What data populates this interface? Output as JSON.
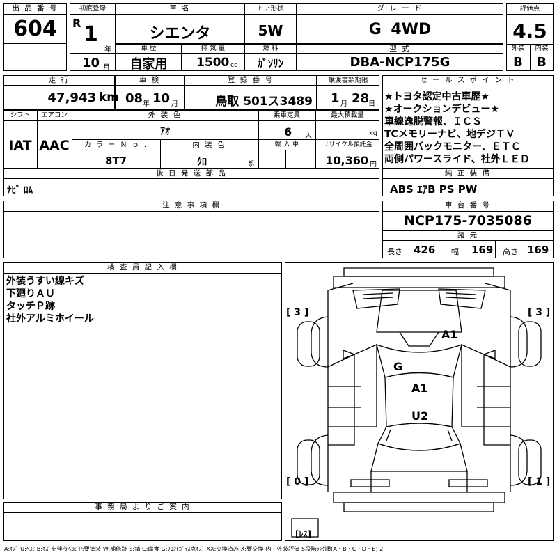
{
  "header": {
    "lot_no_label": "出 品 番 号",
    "lot_no": "604",
    "first_reg_label": "初度登録",
    "first_reg_era": "R",
    "first_reg_year": "1",
    "year_unit": "年",
    "first_reg_month": "10",
    "month_unit": "月",
    "car_name_label": "車 名",
    "car_name": "シエンタ",
    "door_label": "ドア形状",
    "door": "5W",
    "grade_label": "グ レ ー ド",
    "grade": "G 4WD",
    "score_label": "評価点",
    "score": "4.5",
    "history_label": "車 歴",
    "history": "自家用",
    "displacement_label": "排 気 量",
    "displacement": "1500",
    "displacement_unit": "cc",
    "fuel_label": "燃 料",
    "fuel": "ｶﾞｿﾘﾝ",
    "model_label": "型 式",
    "model": "DBA-NCP175G",
    "exterior_label": "外装",
    "exterior_grade": "B",
    "interior_label": "内装",
    "interior_grade": "B"
  },
  "row2": {
    "mileage_label": "走 行",
    "mileage": "47,943",
    "mileage_unit": "km",
    "inspection_label": "車 検",
    "inspection_year": "08",
    "inspection_year_unit": "年",
    "inspection_month": "10",
    "inspection_month_unit": "月",
    "plate_label": "登 録 番 号",
    "plate": "鳥取 501ス3489",
    "transfer_label": "譲渡書類期限",
    "transfer_month": "1",
    "transfer_month_unit": "月",
    "transfer_day": "28",
    "transfer_day_unit": "日"
  },
  "row3": {
    "shift_label": "シフト",
    "shift": "IAT",
    "ac_label": "エアコン",
    "ac": "AAC",
    "ext_color_label": "外 装 色",
    "ext_color": "ｱｵ",
    "capacity_label": "乗車定員",
    "capacity": "6",
    "capacity_unit": "人",
    "max_load_label": "最大積載量",
    "max_load_unit": "kg",
    "color_no_label": "カ ラ ー Ｎ ｏ .",
    "color_no": "8T7",
    "int_color_label": "内 装 色",
    "int_color": "ｸﾛ",
    "int_color_unit": "系",
    "import_label": "輸 入 車",
    "recycle_label": "リサイクル預託金",
    "recycle": "10,360",
    "recycle_unit": "円"
  },
  "later_parts": {
    "label": "後 日 発 送 部 品",
    "value": "ﾅﾋﾞ ﾛﾑ"
  },
  "notes": {
    "label": "注 意 事 項 欄"
  },
  "sales_points": {
    "label": "セ ー ル ス ポ イ ン ト",
    "lines": [
      "★トヨタ認定中古車歴★",
      "★オークションデビュー★",
      "車線逸脱警報、ＩＣＳ",
      "TCメモリーナビ、地デジＴＶ",
      "全周囲バックモニター、ＥＴＣ",
      "両側パワースライド、社外ＬＥＤ"
    ]
  },
  "genuine_equipment": {
    "label": "純 正 装 備",
    "value": "ABS ｴｱB PS PW"
  },
  "chassis": {
    "label": "車 台 番 号",
    "value": "NCP175-7035086"
  },
  "dimensions": {
    "label": "諸 元",
    "length_label": "長さ",
    "length": "426",
    "width_label": "幅",
    "width": "169",
    "height_label": "高さ",
    "height": "169"
  },
  "inspector": {
    "label": "検 査 員 記 入 欄",
    "lines": [
      "外装うすい線キズ",
      "下廻りＡＵ",
      "タッチＰ跡",
      "社外アルミホイール"
    ]
  },
  "office": {
    "label": "事 務 局 よ り ご 案 内"
  },
  "diagram": {
    "tl": "[ 3 ]",
    "tr": "[ 3 ]",
    "bl": "[ 0 ]",
    "br": "[ 1 ]",
    "spare": "[ﾚｽ]",
    "marks": {
      "roof": "A1",
      "front_glass": "G",
      "hood": "A1",
      "under": "U2"
    }
  },
  "legend": "A:ｷｽﾞ U:ﾍｺﾐ B:ｷｽﾞを伴うﾍｺﾐ P:要塗装 W:補修跡 S:錆 C:腐食 G:ﾌﾛﾝﾄｶﾞﾗｽ点ｷｽﾞ XX:交換済み X:要交換 内・外装評価 5段階ﾗﾝｸ順(A・B・C・D・E) 2"
}
